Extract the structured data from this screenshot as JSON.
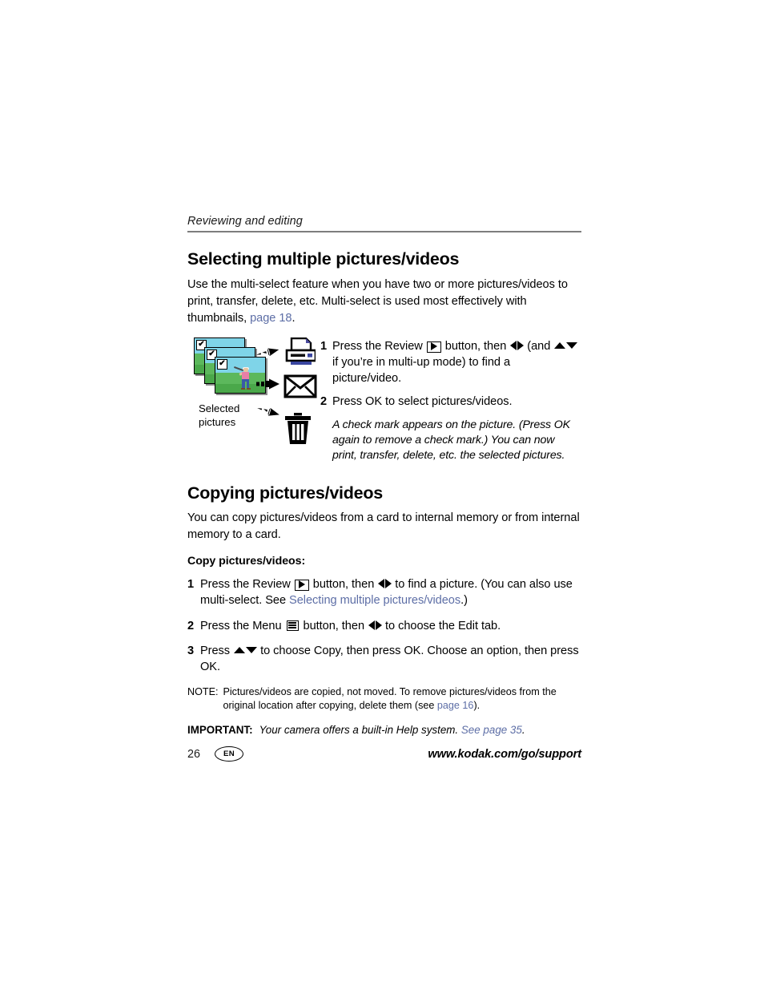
{
  "running_head": "Reviewing and editing",
  "section1": {
    "title": "Selecting multiple pictures/videos",
    "intro_a": "Use the multi-select feature when you have two or more pictures/videos to print, transfer, delete, etc. Multi-select is used most effectively with thumbnails, ",
    "intro_link": "page 18",
    "intro_b": ".",
    "figure": {
      "caption_line1": "Selected",
      "caption_line2": "pictures",
      "thumb_check": "✔",
      "icons": [
        "printer-icon",
        "envelope-icon",
        "trash-icon"
      ],
      "arrows": [
        "arrow-up-right",
        "arrow-right",
        "arrow-down-right"
      ]
    },
    "steps": [
      {
        "num": "1",
        "text_a": "Press the Review ",
        "glyph1": "review-button",
        "text_b": " button, then ",
        "glyph2": "left-right-arrows",
        "text_c": " (and ",
        "glyph3": "up-down-arrows",
        "text_d": " if you’re in multi-up mode) to find a picture/video."
      },
      {
        "num": "2",
        "text_a": "Press OK to select pictures/videos."
      }
    ],
    "step_note": "A check mark appears on the picture. (Press OK again to remove a check mark.) You can now print, transfer, delete, etc. the selected pictures."
  },
  "section2": {
    "title": "Copying pictures/videos",
    "intro": "You can copy pictures/videos from a card to internal memory or from internal memory to a card.",
    "sub_head": "Copy pictures/videos:",
    "steps": [
      {
        "num": "1",
        "text_a": "Press the Review ",
        "text_b": " button, then ",
        "text_c": " to find a picture. (You can also use multi-select. See ",
        "link": "Selecting multiple pictures/videos",
        "text_d": ".)"
      },
      {
        "num": "2",
        "text_a": "Press the Menu ",
        "text_b": " button, then ",
        "text_c": " to choose the Edit tab."
      },
      {
        "num": "3",
        "text_a": "Press ",
        "text_b": " to choose Copy, then press OK. Choose an option, then press OK."
      }
    ],
    "note": {
      "label": "NOTE:",
      "text_a": "Pictures/videos are copied, not moved. To remove pictures/videos from the original location after copying, delete them (see ",
      "link": "page 16",
      "text_b": ")."
    },
    "important": {
      "label": "IMPORTANT:",
      "text": "Your camera offers a built-in Help system. ",
      "link": "See page 35",
      "text_b": "."
    }
  },
  "footer": {
    "page_number": "26",
    "language": "EN",
    "url": "www.kodak.com/go/support"
  },
  "colors": {
    "link": "#5d6ea6",
    "rule": "#7d7d7d",
    "text": "#000000"
  }
}
